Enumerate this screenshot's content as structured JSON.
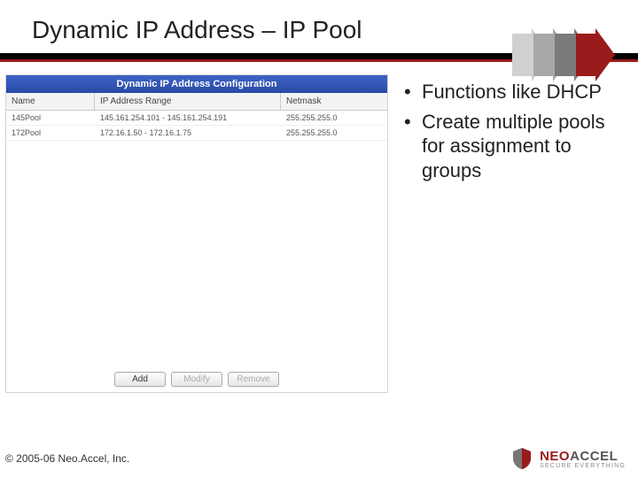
{
  "slide": {
    "title": "Dynamic IP Address – IP Pool"
  },
  "panel": {
    "header": "Dynamic IP Address Configuration",
    "columns": {
      "name": "Name",
      "range": "IP Address Range",
      "mask": "Netmask"
    },
    "rows": [
      {
        "name": "145Pool",
        "range": "145.161.254.101 - 145.161.254.191",
        "mask": "255.255.255.0"
      },
      {
        "name": "172Pool",
        "range": "172.16.1.50 - 172.16.1.75",
        "mask": "255.255.255.0"
      }
    ],
    "buttons": {
      "add": "Add",
      "modify": "Modify",
      "remove": "Remove"
    }
  },
  "bullets": {
    "items": [
      "Functions like DHCP",
      "Create multiple pools for assignment to groups"
    ]
  },
  "footer": {
    "copyright": "© 2005-06 Neo.Accel, Inc.",
    "brand_neo": "NEO",
    "brand_accel": "ACCEL",
    "tagline": "SECURE EVERYTHING"
  }
}
